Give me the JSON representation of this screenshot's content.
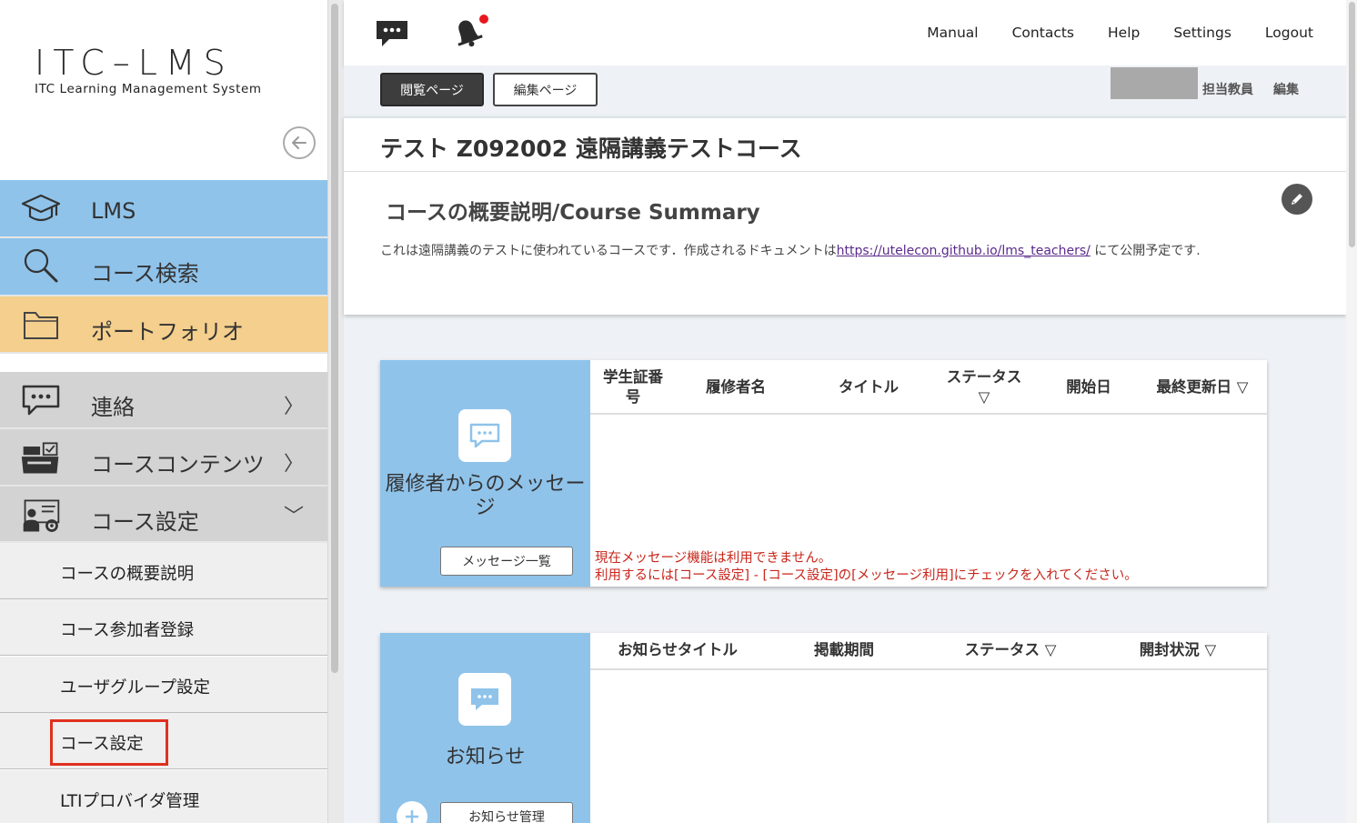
{
  "sidebar": {
    "logo_main": "ITC–LMS",
    "logo_sub": "ITC Learning Management System",
    "nav": [
      {
        "label": "LMS",
        "icon": "graduation-cap-icon"
      },
      {
        "label": "コース検索",
        "icon": "search-icon"
      },
      {
        "label": "ポートフォリオ",
        "icon": "folder-icon"
      },
      {
        "label": "連絡",
        "icon": "chat-icon",
        "chevron": "〉"
      },
      {
        "label": "コースコンテンツ",
        "icon": "course-contents-icon",
        "chevron": "〉"
      },
      {
        "label": "コース設定",
        "icon": "course-settings-icon",
        "chevron": "﹀"
      }
    ],
    "sub_items": [
      {
        "label": "コースの概要説明"
      },
      {
        "label": "コース参加者登録"
      },
      {
        "label": "ユーザグループ設定"
      },
      {
        "label": "コース設定",
        "highlighted": true
      },
      {
        "label": "LTIプロバイダ管理"
      }
    ]
  },
  "topbar": {
    "links": [
      "Manual",
      "Contacts",
      "Help",
      "Settings",
      "Logout"
    ],
    "icons": [
      "chat-bubble-icon",
      "bell-icon"
    ]
  },
  "modebar": {
    "view_page": "閲覧ページ",
    "edit_page": "編集ページ",
    "teacher_label": "担当教員",
    "teacher_edit": "編集"
  },
  "course": {
    "title": "テスト Z092002 遠隔講義テストコース",
    "summary_title": "コースの概要説明/Course Summary",
    "summary_before": "これは遠隔講義のテストに使われているコースです．作成されるドキュメントは",
    "summary_link": "https://utelecon.github.io/lms_teachers/",
    "summary_after": " にて公開予定です."
  },
  "message_card": {
    "label": "履修者からのメッセージ",
    "button": "メッセージ一覧",
    "columns": [
      "学生証番号",
      "履修者名",
      "タイトル",
      "ステータス ▽",
      "開始日",
      "最終更新日 ▽"
    ],
    "warning_line1": "現在メッセージ機能は利用できません。",
    "warning_line2": "利用するには[コース設定] - [コース設定]の[メッセージ利用]にチェックを入れてください。"
  },
  "notice_card": {
    "label": "お知らせ",
    "button": "お知らせ管理",
    "columns": [
      "お知らせタイトル",
      "掲載期間",
      "ステータス ▽",
      "開封状況 ▽"
    ]
  },
  "colors": {
    "accent_blue": "#8fc3ea",
    "portfolio_orange": "#f4cf8d",
    "highlight_red": "#e0311f",
    "warning_red": "#c8261b",
    "notification_dot": "#e8171f"
  }
}
